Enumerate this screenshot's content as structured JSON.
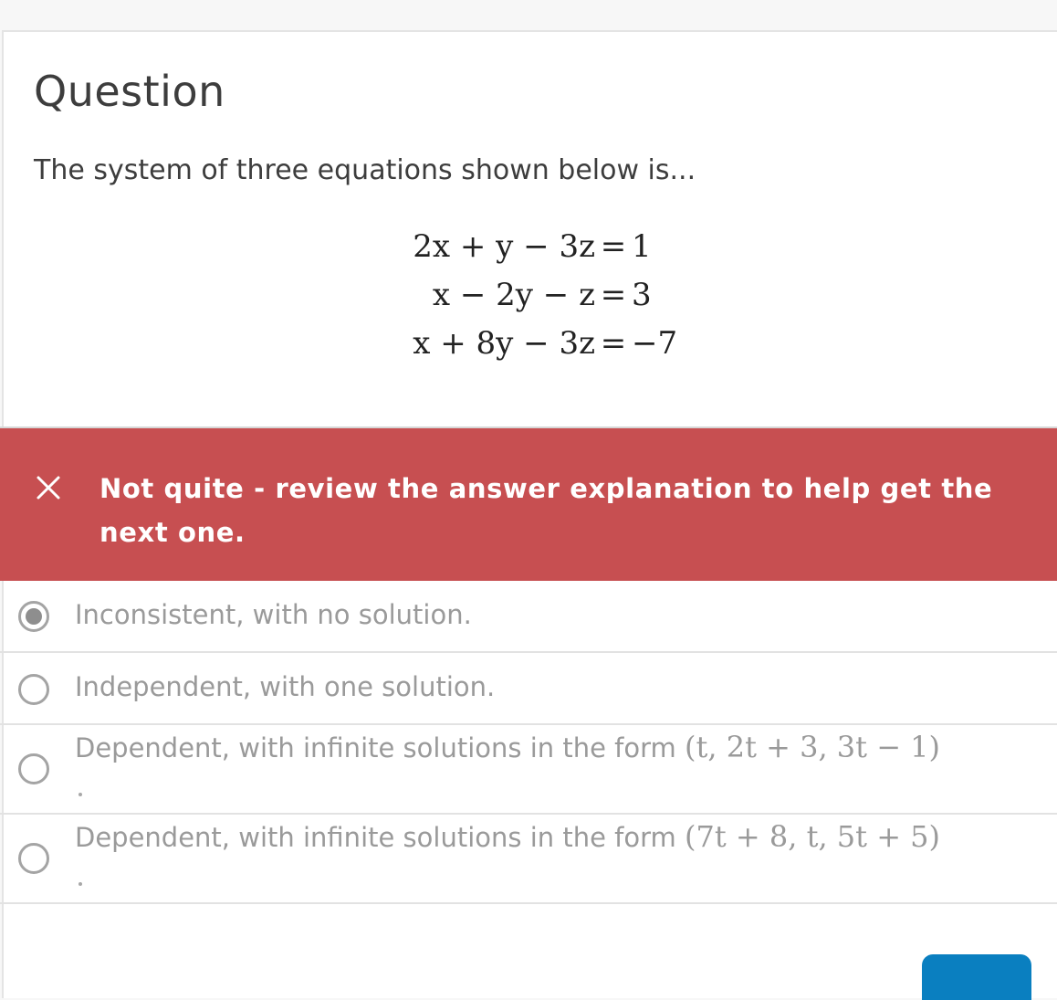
{
  "question": {
    "heading": "Question",
    "prompt": "The system of three equations shown below is...",
    "equations": [
      {
        "lhs": "2x + y − 3z",
        "eq": "=",
        "rhs": "1"
      },
      {
        "lhs": "x − 2y − z",
        "eq": "=",
        "rhs": "3"
      },
      {
        "lhs": "x + 8y − 3z",
        "eq": "=",
        "rhs": "−7"
      }
    ]
  },
  "feedback": {
    "status": "incorrect",
    "icon": "close-icon",
    "message": "Not quite - review the answer explanation to help get the next one.",
    "background_color": "#c74f51"
  },
  "options": [
    {
      "text": "Inconsistent, with no solution.",
      "math": "",
      "selected": true
    },
    {
      "text": "Independent, with one solution.",
      "math": "",
      "selected": false
    },
    {
      "text": "Dependent, with infinite solutions in the form ",
      "math": "(t, 2t + 3, 3t − 1)",
      "selected": false
    },
    {
      "text": "Dependent, with infinite solutions in the form ",
      "math": "(7t + 8, t, 5t + 5)",
      "selected": false
    }
  ],
  "colors": {
    "accent_button": "#0a7fc0"
  }
}
